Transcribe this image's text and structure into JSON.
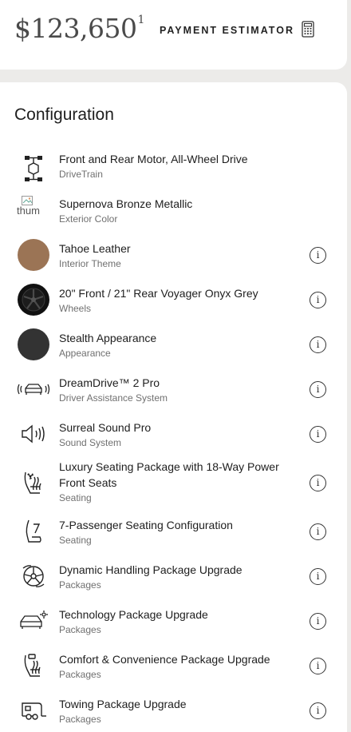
{
  "header": {
    "price": "$123,650",
    "price_footnote": "1",
    "estimator_label": "PAYMENT ESTIMATOR",
    "calculator_icon": "calculator-icon"
  },
  "configuration": {
    "title": "Configuration",
    "items": [
      {
        "label": "Front and Rear Motor, All-Wheel Drive",
        "sub": "DriveTrain",
        "icon": "drivetrain-icon",
        "info": false
      },
      {
        "label": "Supernova Bronze Metallic",
        "sub": "Exterior Color",
        "icon": "broken-image-icon",
        "alt": "thum",
        "info": false
      },
      {
        "label": "Tahoe Leather",
        "sub": "Interior Theme",
        "icon": "leather-swatch",
        "color": "#9b7455",
        "info": true
      },
      {
        "label": "20\" Front / 21\" Rear Voyager Onyx Grey",
        "sub": "Wheels",
        "icon": "wheel-icon",
        "info": true
      },
      {
        "label": "Stealth Appearance",
        "sub": "Appearance",
        "icon": "appearance-swatch",
        "color": "#333333",
        "info": true
      },
      {
        "label": "DreamDrive™ 2 Pro",
        "sub": "Driver Assistance System",
        "icon": "car-sensor-icon",
        "info": true
      },
      {
        "label": "Surreal Sound Pro",
        "sub": "Sound System",
        "icon": "speaker-icon",
        "info": true
      },
      {
        "label": "Luxury Seating Package with 18-Way Power Front Seats",
        "sub": "Seating",
        "icon": "seat-fan-icon",
        "info": true
      },
      {
        "label": "7-Passenger Seating Configuration",
        "sub": "Seating",
        "icon": "seat-seven-icon",
        "info": true
      },
      {
        "label": "Dynamic Handling Package Upgrade",
        "sub": "Packages",
        "icon": "handling-wheel-icon",
        "info": true
      },
      {
        "label": "Technology Package Upgrade",
        "sub": "Packages",
        "icon": "car-tech-icon",
        "info": true
      },
      {
        "label": "Comfort & Convenience Package Upgrade",
        "sub": "Packages",
        "icon": "seat-heat-icon",
        "info": true
      },
      {
        "label": "Towing Package Upgrade",
        "sub": "Packages",
        "icon": "trailer-icon",
        "info": true
      }
    ],
    "info_glyph": "i"
  }
}
